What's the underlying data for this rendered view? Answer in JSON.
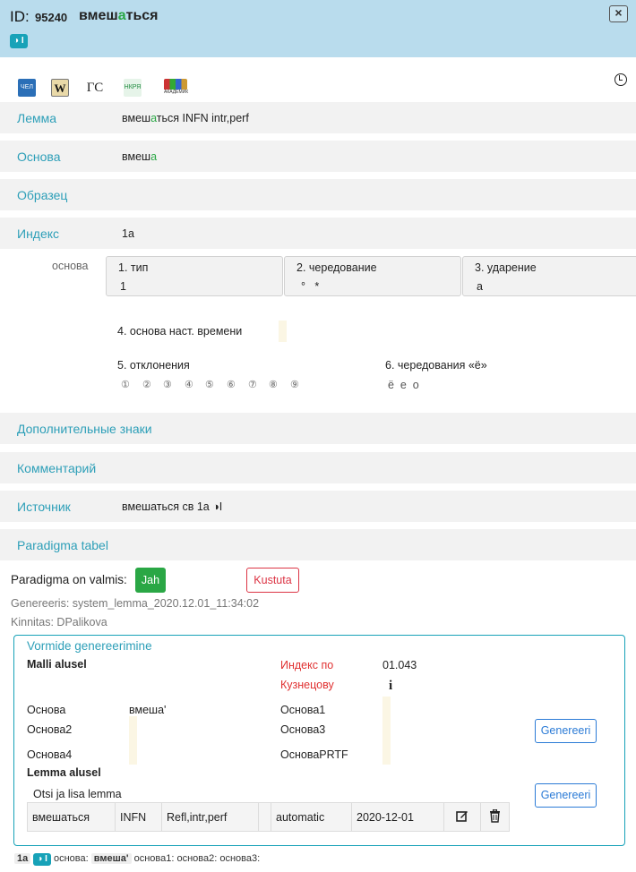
{
  "header": {
    "id_label": "ID:",
    "id_number": "95240",
    "word_before": "вмеш",
    "word_stressed": "а",
    "word_after": "ться",
    "aspect_badge": "◑ I",
    "close_icon": "close-icon"
  },
  "sources": [
    "ЧЕЛ",
    "W",
    "ГС",
    "НКРЯ",
    "АКАДЕМИК"
  ],
  "fields": {
    "lemma": {
      "label": "Лемма",
      "value_before": "вмеш",
      "value_stressed": "а",
      "value_after": "ться INFN intr,perf"
    },
    "stem": {
      "label": "Основа",
      "value_before": "вмеш",
      "value_stressed": "а"
    },
    "pattern": {
      "label": "Образец"
    },
    "index": {
      "label": "Индекс",
      "value": "1а"
    }
  },
  "index_details": {
    "stem_label": "основа",
    "type_label": "1. тип",
    "type_value": "1",
    "alternation_label": "2. чередование",
    "alternation_value": "°   *",
    "stress_label": "3. ударение",
    "stress_value": "a",
    "present_stem_label": "4. основа наст. времени",
    "deviations_label": "5. отклонения",
    "deviations": [
      "①",
      "②",
      "③",
      "④",
      "⑤",
      "⑥",
      "⑦",
      "⑧",
      "⑨"
    ],
    "yo_label": "6. чередования «ё»",
    "yo_value": "ё  е  о"
  },
  "more_fields": {
    "extra_marks": "Дополнительные знаки",
    "comment": "Комментарий",
    "source_label": "Источник",
    "source_value": "вмешаться св 1а ◑I",
    "paradigm_table": "Paradigma tabel"
  },
  "paradigm": {
    "ready_label": "Paradigma on valmis:",
    "yes_button": "Jah",
    "delete_button": "Kustuta",
    "generated": "Genereeris: system_lemma_2020.12.01_11:34:02",
    "confirmed": "Kinnitas: DPalikova"
  },
  "generation": {
    "title": "Vormide genereerimine",
    "by_model": "Malli alusel",
    "kuznetsov_label_1": "Индекс по",
    "kuznetsov_label_2": "Кузнецову",
    "kuznetsov_value": "01.043",
    "info_icon": "info-icon",
    "stem_label": "Основа",
    "stem_value": "вмеша'",
    "stem1_label": "Основа1",
    "stem2_label": "Основа2",
    "stem3_label": "Основа3",
    "stem4_label": "Основа4",
    "stemprtf_label": "ОсноваPRTF",
    "generate_button": "Genereeri",
    "by_lemma": "Lemma alusel",
    "search_lemma": "Otsi ja lisa lemma",
    "generate_button_2": "Genereeri",
    "lemma_row": [
      "вмешаться",
      "INFN",
      "Refl,intr,perf",
      "",
      "automatic",
      "2020-12-01"
    ]
  },
  "footer": {
    "index": "1a",
    "aspect": "◑ I",
    "stem_label": "основа:",
    "stem_value": "вмеша'",
    "rest": "основа1: основа2: основа3:"
  },
  "colors": {
    "header_bg": "#b9dced",
    "accent": "#2d9fb8",
    "success": "#2aa745",
    "danger": "#dc3545",
    "primary": "#2b7bd6"
  }
}
